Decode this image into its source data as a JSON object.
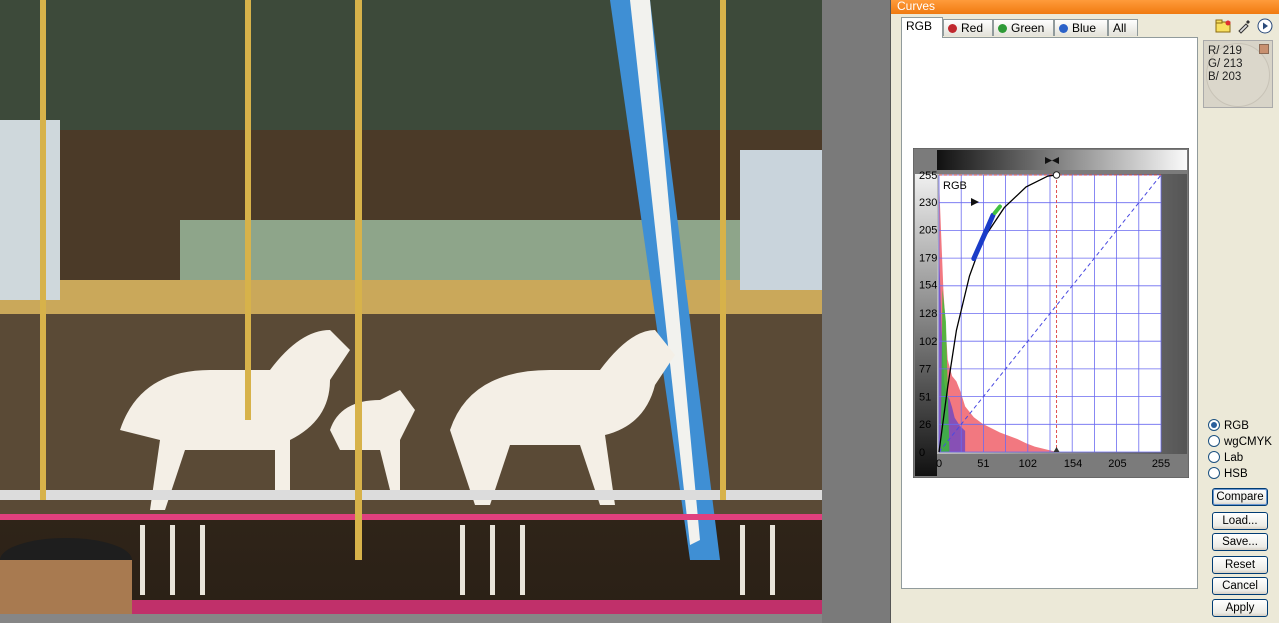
{
  "window": {
    "title": "Curves"
  },
  "tabs": [
    {
      "label": "RGB",
      "active": true,
      "dot": null
    },
    {
      "label": "Red",
      "active": false,
      "dot": "#c0282e"
    },
    {
      "label": "Green",
      "active": false,
      "dot": "#2e9a36"
    },
    {
      "label": "Blue",
      "active": false,
      "dot": "#2b62c8"
    },
    {
      "label": "All",
      "active": false,
      "dot": null
    }
  ],
  "toolbar_icons": [
    "folder-icon",
    "eyedropper-icon",
    "play-icon"
  ],
  "picker": {
    "r": "R/ 219",
    "g": "G/ 213",
    "b": "B/ 203"
  },
  "chart_data": {
    "type": "line",
    "channel_label": "RGB",
    "xlim": [
      0,
      255
    ],
    "ylim": [
      0,
      255
    ],
    "x_ticks": [
      "0",
      "51",
      "102",
      "154",
      "205",
      "255"
    ],
    "y_ticks": [
      "255",
      "230",
      "205",
      "179",
      "154",
      "128",
      "102",
      "77",
      "51",
      "26",
      "0"
    ],
    "grid": true,
    "series": [
      {
        "x": [
          0,
          10,
          20,
          35,
          50,
          75,
          100,
          125,
          135
        ],
        "y": [
          0,
          60,
          112,
          162,
          195,
          225,
          244,
          254,
          255
        ]
      }
    ],
    "diagonal": [
      [
        0,
        0
      ],
      [
        255,
        255
      ]
    ],
    "marker_x": 135,
    "histogram": {
      "x": [
        0,
        5,
        10,
        15,
        20,
        25,
        30,
        40,
        50,
        60,
        70,
        80,
        90,
        100,
        110,
        120,
        130,
        135
      ],
      "y": [
        250,
        150,
        85,
        70,
        65,
        55,
        42,
        32,
        26,
        22,
        18,
        15,
        12,
        8,
        5,
        3,
        1,
        0
      ]
    },
    "colors": {
      "curve": "#000000",
      "grid": "#6a6af0",
      "diagonal": "#4a4ae0",
      "marker": "#e05050",
      "red_hist": "#f0606a",
      "green_hist": "#30c030",
      "blue_hist": "#3030e0"
    }
  },
  "color_modes": [
    {
      "label": "RGB",
      "selected": true
    },
    {
      "label": "wgCMYK",
      "selected": false
    },
    {
      "label": "Lab",
      "selected": false
    },
    {
      "label": "HSB",
      "selected": false
    }
  ],
  "buttons": {
    "compare": "Compare",
    "load": "Load...",
    "save": "Save...",
    "reset": "Reset",
    "cancel": "Cancel",
    "apply": "Apply"
  }
}
